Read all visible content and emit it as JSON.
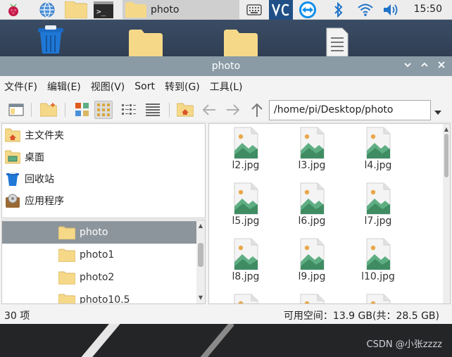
{
  "taskbar": {
    "task_label": "photo",
    "clock": "15:50"
  },
  "window": {
    "title": "photo",
    "menu": [
      {
        "label": "文件(F)"
      },
      {
        "label": "编辑(E)"
      },
      {
        "label": "视图(V)"
      },
      {
        "label": "Sort"
      },
      {
        "label": "转到(G)"
      },
      {
        "label": "工具(L)"
      }
    ],
    "path": "/home/pi/Desktop/photo"
  },
  "places": [
    {
      "label": "主文件夹",
      "icon": "home-folder-icon"
    },
    {
      "label": "桌面",
      "icon": "desktop-folder-icon"
    },
    {
      "label": "回收站",
      "icon": "trash-icon"
    },
    {
      "label": "应用程序",
      "icon": "applications-icon"
    }
  ],
  "tree": [
    {
      "label": "photo",
      "selected": true
    },
    {
      "label": "photo1"
    },
    {
      "label": "photo2"
    },
    {
      "label": "photo10.5"
    }
  ],
  "files": [
    {
      "label": "l2.jpg"
    },
    {
      "label": "l3.jpg"
    },
    {
      "label": "l4.jpg"
    },
    {
      "label": "l5.jpg"
    },
    {
      "label": "l6.jpg"
    },
    {
      "label": "l7.jpg"
    },
    {
      "label": "l8.jpg"
    },
    {
      "label": "l9.jpg"
    },
    {
      "label": "l10.jpg"
    }
  ],
  "status": {
    "count": "30 项",
    "free_space": "可用空间：13.9 GB(共：28.5 GB)"
  },
  "watermark": "CSDN @小张zzzz",
  "colors": {
    "titlebar": "#8a9ba6",
    "selection": "#8d959c",
    "folder": "#f5d989",
    "image_green": "#5fae83"
  }
}
